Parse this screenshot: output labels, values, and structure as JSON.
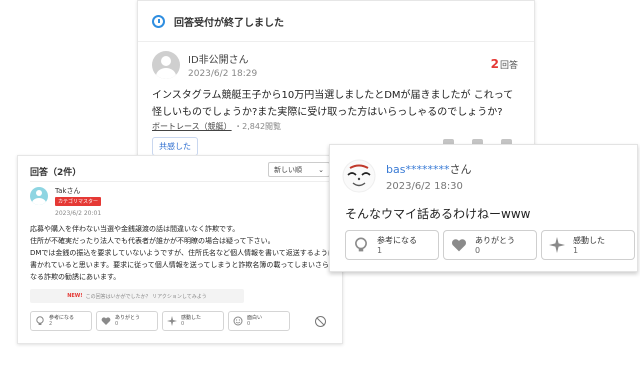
{
  "question": {
    "status": "回答受付が終了しました",
    "user": "ID非公開さん",
    "date": "2023/6/2 18:29",
    "answer_count_num": "2",
    "answer_count_label": "回答",
    "body": "インスタグラム競艇王子から10万円当選しましたとDMが届きましたが これって怪しいものでしょうか?また実際に受け取った方はいらっしゃるのでしょうか?",
    "category": "ボートレース（競艇）",
    "views": "・2,842閲覧",
    "empathy_button": "共感した"
  },
  "answers": {
    "header": "回答（2件）",
    "sort": "新しい順",
    "sort_icon": "chevron-down",
    "user": "Takさん",
    "badge": "カテゴリマスター",
    "date": "2023/6/2 20:01",
    "body": [
      "応募や購入を伴わない当選や金銭譲渡の話は間違いなく詐欺です。",
      "住所が不確実だったり法人でも代表者が誰かが不明瞭の場合は疑って下さい。",
      "DMでは金銭の振込を要求していないようですが、住所氏名など個人情報を書いて返送するように書かれていると思います。要求に従って個人情報を送ってしまうと詐欺名簿の載ってしまいさらなる詐欺の勧誘にあいます。"
    ],
    "feedback_new": "NEW!",
    "feedback_text": "この回答はいかがでしたか？ リアクションしてみよう",
    "reactions": [
      {
        "label": "参考になる",
        "count": "2",
        "icon": "bulb"
      },
      {
        "label": "ありがとう",
        "count": "0",
        "icon": "heart"
      },
      {
        "label": "感動した",
        "count": "0",
        "icon": "sparkle"
      },
      {
        "label": "面白い",
        "count": "0",
        "icon": "smile"
      }
    ]
  },
  "zoom_answer": {
    "user_link": "bas********",
    "user_suffix": "さん",
    "date": "2023/6/2 18:30",
    "body": "そんなウマイ話あるわけねーwww",
    "reactions": [
      {
        "label": "参考になる",
        "count": "1",
        "icon": "bulb"
      },
      {
        "label": "ありがとう",
        "count": "0",
        "icon": "heart"
      },
      {
        "label": "感動した",
        "count": "1",
        "icon": "sparkle"
      }
    ]
  },
  "colors": {
    "accent_red": "#e53935",
    "link_blue": "#3a7bd5",
    "icon_grey": "#8a8a8a"
  }
}
